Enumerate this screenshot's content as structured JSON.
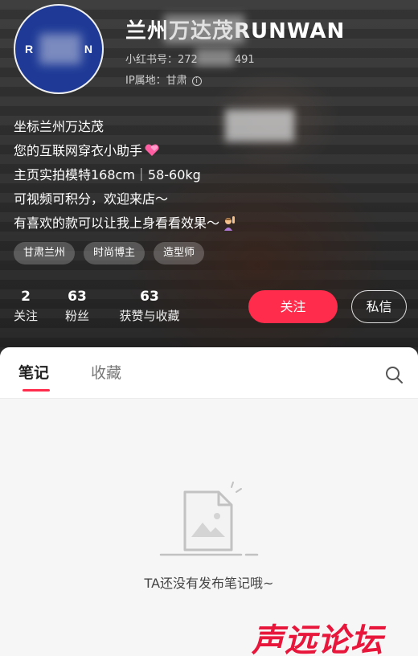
{
  "profile": {
    "username": "兰州万达茂RUNWAN",
    "xhs_id_label": "小红书号：272",
    "xhs_id_tail": "491",
    "ip_label": "IP属地：甘肃",
    "avatar_letters": [
      "R",
      "N"
    ]
  },
  "bio": {
    "lines": [
      "坐标兰州万达茂",
      "您的互联网穿衣小助手",
      "主页实拍模特168cm｜58-60kg",
      "可视频可积分，欢迎来店～",
      "有喜欢的款可以让我上身看看效果～"
    ]
  },
  "tags": [
    "甘肃兰州",
    "时尚博主",
    "造型师"
  ],
  "stats": [
    {
      "value": "2",
      "label": "关注"
    },
    {
      "value": "63",
      "label": "粉丝"
    },
    {
      "value": "63",
      "label": "获赞与收藏"
    }
  ],
  "actions": {
    "follow": "关注",
    "message": "私信"
  },
  "tabs": {
    "notes": "笔记",
    "favorites": "收藏"
  },
  "empty_state": {
    "text": "TA还没有发布笔记哦~"
  },
  "watermark": "声远论坛",
  "colors": {
    "accent": "#ff2d4b",
    "avatar_bg": "#1e3a96",
    "watermark": "#e8163b"
  },
  "icons": [
    "info-icon",
    "heart-emoji-icon",
    "person-raising-hand-emoji-icon",
    "search-icon",
    "empty-notes-icon"
  ]
}
